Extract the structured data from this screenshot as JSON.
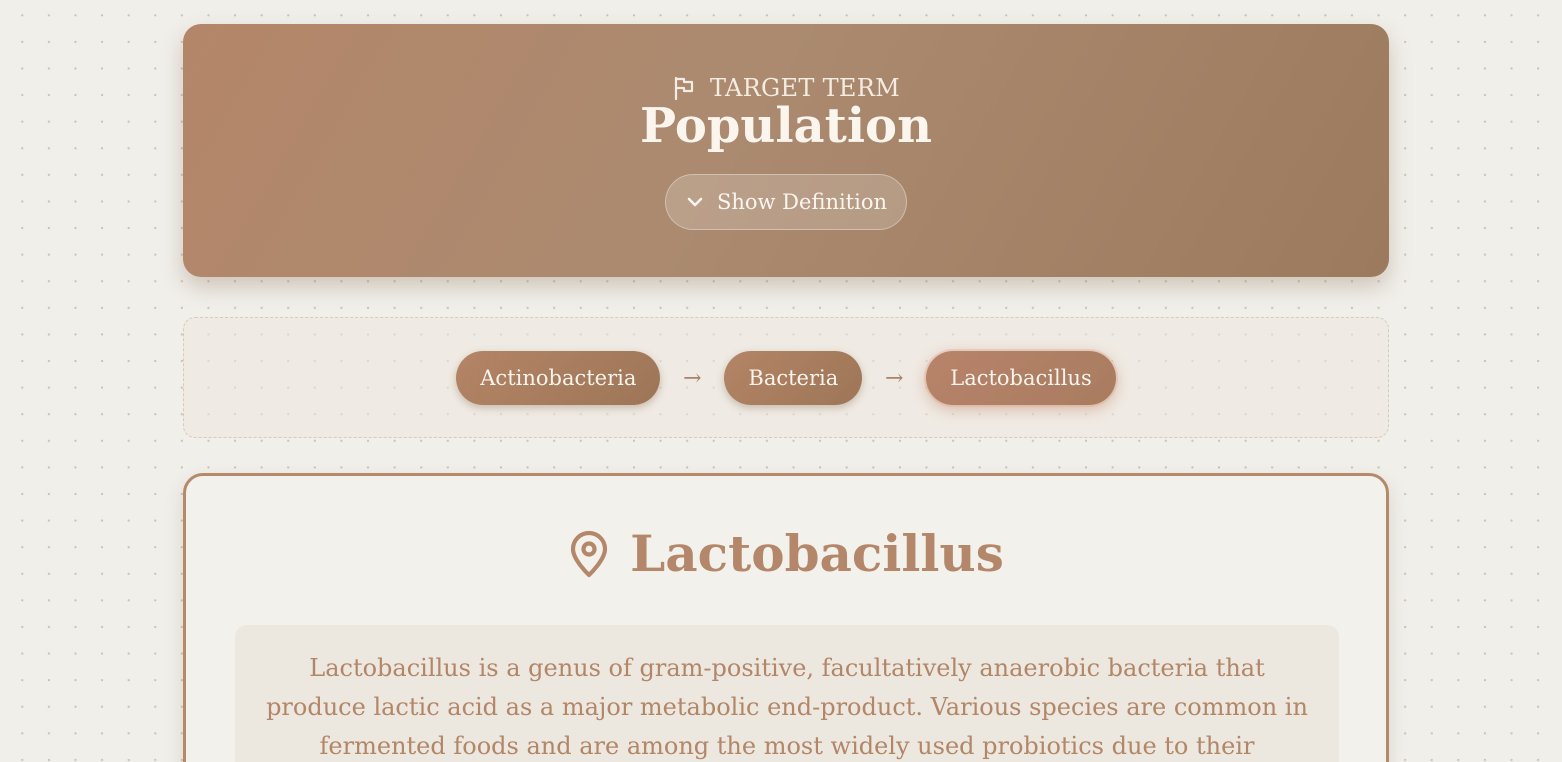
{
  "target": {
    "label": "TARGET TERM",
    "icon": "flag-icon",
    "term": "Population",
    "definition_button": "Show Definition",
    "button_icon": "chevron-down-icon"
  },
  "path": {
    "items": [
      {
        "label": "Actinobacteria"
      },
      {
        "label": "Bacteria"
      },
      {
        "label": "Lactobacillus"
      }
    ],
    "arrow": "→",
    "active_index": 2
  },
  "detail": {
    "icon": "map-pin-icon",
    "title": "Lactobacillus",
    "description": "Lactobacillus is a genus of gram-positive, facultatively anaerobic bacteria that produce lactic acid as a major metabolic end-product. Various species are common in fermented foods and are among the most widely used probiotics due to their beneficial effects on"
  },
  "colors": {
    "accent": "#b48a6b",
    "background": "#f1efea",
    "text_on_accent": "#fbf5ee"
  }
}
